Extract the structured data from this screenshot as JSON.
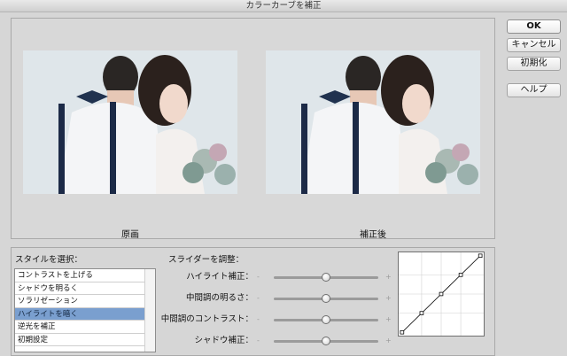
{
  "window": {
    "title": "カラーカーブを補正"
  },
  "preview": {
    "original_caption": "原画",
    "corrected_caption": "補正後"
  },
  "buttons": {
    "ok": "OK",
    "cancel": "キャンセル",
    "reset": "初期化",
    "help": "ヘルプ"
  },
  "style_section": {
    "label": "スタイルを選択：",
    "items": [
      "コントラストを上げる",
      "シャドウを明るく",
      "ソラリゼーション",
      "ハイライトを暗く",
      "逆光を補正",
      "初期設定"
    ],
    "selected_index": 3
  },
  "slider_section": {
    "label": "スライダーを調整：",
    "minus": "-",
    "plus": "+",
    "sliders": [
      {
        "label": "ハイライト補正：",
        "value": 0.5
      },
      {
        "label": "中間調の明るさ：",
        "value": 0.5
      },
      {
        "label": "中間調のコントラスト：",
        "value": 0.5
      },
      {
        "label": "シャドウ補正：",
        "value": 0.5
      }
    ]
  },
  "curve": {
    "points": [
      [
        0,
        0
      ],
      [
        0.25,
        0.25
      ],
      [
        0.5,
        0.5
      ],
      [
        0.75,
        0.75
      ],
      [
        1,
        1
      ]
    ]
  },
  "colors": {
    "selection": "#7a9fcf",
    "curve_line": "#000000",
    "curve_grid": "#d0d0d0"
  }
}
